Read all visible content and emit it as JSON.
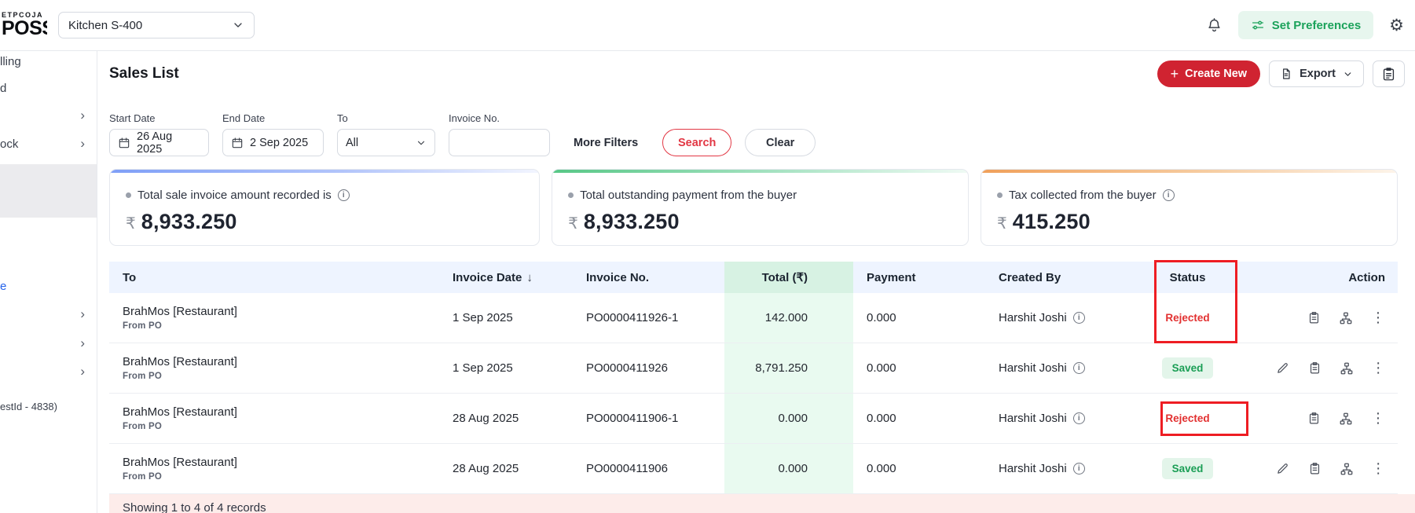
{
  "brand": {
    "logo_top": "ETPCOJA",
    "logo_main": "POSS"
  },
  "topbar": {
    "outlet_value": "Kitchen S-400",
    "set_preferences_label": "Set Preferences"
  },
  "sidebar": {
    "items": [
      {
        "label": "lling"
      },
      {
        "label": "d"
      },
      {
        "label": ""
      },
      {
        "label": "ock"
      },
      {
        "label": ""
      },
      {
        "label": ""
      },
      {
        "label": "e"
      },
      {
        "label": ""
      },
      {
        "label": ""
      },
      {
        "label": ""
      },
      {
        "label": "estId - 4838)"
      }
    ]
  },
  "page": {
    "title": "Sales List",
    "create_new_label": "Create New",
    "export_label": "Export"
  },
  "filters": {
    "start_date_label": "Start Date",
    "start_date_value": "26 Aug 2025",
    "end_date_label": "End Date",
    "end_date_value": "2 Sep 2025",
    "to_label": "To",
    "to_value": "All",
    "invoice_no_label": "Invoice No.",
    "invoice_no_value": "",
    "more_filters_label": "More Filters",
    "search_label": "Search",
    "clear_label": "Clear"
  },
  "summary_cards": [
    {
      "label": "Total sale invoice amount recorded is",
      "currency": "₹",
      "amount": "8,933.250",
      "accent": "#7f9ff7",
      "has_info": true
    },
    {
      "label": "Total outstanding payment from the buyer",
      "currency": "₹",
      "amount": "8,933.250",
      "accent": "#57c786",
      "has_info": false
    },
    {
      "label": "Tax collected from the buyer",
      "currency": "₹",
      "amount": "415.250",
      "accent": "#f0a05a",
      "has_info": true
    }
  ],
  "table": {
    "headers": {
      "to": "To",
      "invoice_date": "Invoice Date",
      "sort_icon": "↓",
      "invoice_no": "Invoice No.",
      "total": "Total (₹)",
      "payment": "Payment",
      "created_by": "Created By",
      "status": "Status",
      "action": "Action"
    },
    "rows": [
      {
        "to": "BrahMos [Restaurant]",
        "to_sub": "From PO",
        "invoice_date": "1 Sep 2025",
        "invoice_no": "PO0000411926-1",
        "total": "142.000",
        "payment": "0.000",
        "created_by": "Harshit Joshi",
        "status": "Rejected"
      },
      {
        "to": "BrahMos [Restaurant]",
        "to_sub": "From PO",
        "invoice_date": "1 Sep 2025",
        "invoice_no": "PO0000411926",
        "total": "8,791.250",
        "payment": "0.000",
        "created_by": "Harshit Joshi",
        "status": "Saved"
      },
      {
        "to": "BrahMos [Restaurant]",
        "to_sub": "From PO",
        "invoice_date": "28 Aug 2025",
        "invoice_no": "PO0000411906-1",
        "total": "0.000",
        "payment": "0.000",
        "created_by": "Harshit Joshi",
        "status": "Rejected"
      },
      {
        "to": "BrahMos [Restaurant]",
        "to_sub": "From PO",
        "invoice_date": "28 Aug 2025",
        "invoice_no": "PO0000411906",
        "total": "0.000",
        "payment": "0.000",
        "created_by": "Harshit Joshi",
        "status": "Saved"
      }
    ]
  },
  "footer": {
    "records_text": "Showing 1 to 4 of 4 records"
  },
  "colors": {
    "brand_red": "#d02331",
    "search_red": "#e23744",
    "saved_green": "#1a9e55",
    "rejected_red": "#e23030",
    "annotation_red": "#ee1d23",
    "header_blue_bg": "#eef4ff",
    "total_header_green_bg": "#d7f2e3",
    "total_col_green_bg": "#e9faf0",
    "footer_pink_bg": "#fdecea",
    "set_preferences_green": "#1ba25a"
  }
}
